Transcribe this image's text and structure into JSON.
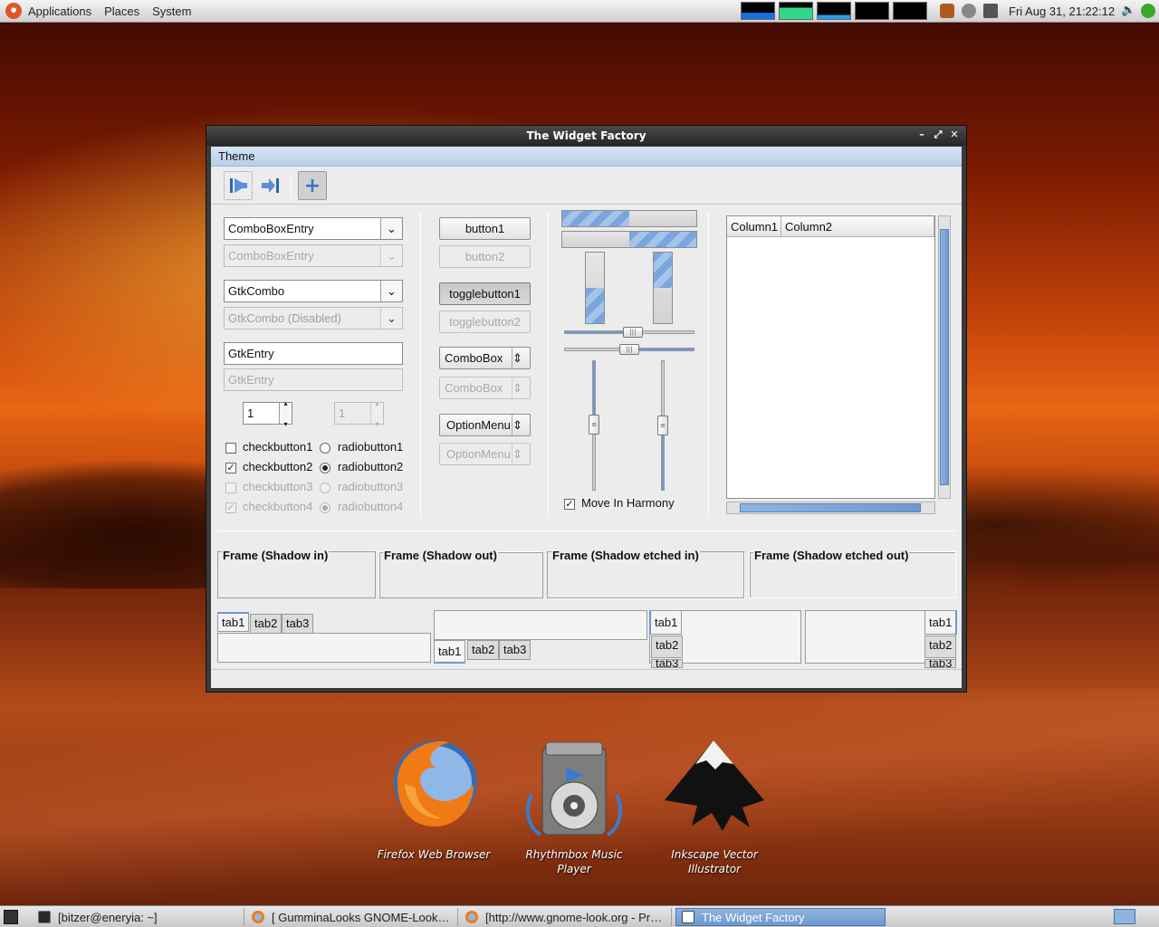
{
  "top_panel": {
    "menus": [
      "Applications",
      "Places",
      "System"
    ],
    "clock": "Fri Aug 31, 21:22:12"
  },
  "bottom_panel": {
    "tasks": [
      {
        "label": "[bitzer@eneryia: ~]",
        "icon": "terminal-icon"
      },
      {
        "label": "[ GumminaLooks GNOME-Look…",
        "icon": "firefox-icon"
      },
      {
        "label": "[http://www.gnome-look.org - Pr…",
        "icon": "firefox-icon"
      },
      {
        "label": "The Widget Factory",
        "icon": "window-icon",
        "active": true
      }
    ]
  },
  "desktop_icons": [
    {
      "label": "Firefox Web Browser",
      "icon": "firefox-icon"
    },
    {
      "label": "Rhythmbox Music Player",
      "icon": "speaker-icon"
    },
    {
      "label": "Inkscape Vector Illustrator",
      "icon": "inkscape-icon"
    }
  ],
  "window": {
    "title": "The Widget Factory",
    "menu": [
      "Theme"
    ],
    "combo_entries": [
      "ComboBoxEntry",
      "ComboBoxEntry",
      "GtkCombo",
      "GtkCombo (Disabled)"
    ],
    "entries": [
      "GtkEntry",
      "GtkEntry"
    ],
    "spinbuttons": [
      "1",
      "1"
    ],
    "checkbuttons": [
      {
        "label": "checkbutton1",
        "checked": false,
        "disabled": false
      },
      {
        "label": "checkbutton2",
        "checked": true,
        "disabled": false
      },
      {
        "label": "checkbutton3",
        "checked": false,
        "disabled": true
      },
      {
        "label": "checkbutton4",
        "checked": true,
        "disabled": true
      }
    ],
    "radiobuttons": [
      {
        "label": "radiobutton1",
        "selected": false,
        "disabled": false
      },
      {
        "label": "radiobutton2",
        "selected": true,
        "disabled": false
      },
      {
        "label": "radiobutton3",
        "selected": false,
        "disabled": true
      },
      {
        "label": "radiobutton4",
        "selected": true,
        "disabled": true
      }
    ],
    "buttons": [
      "button1",
      "button2",
      "togglebutton1",
      "togglebutton2"
    ],
    "comboboxes": [
      "ComboBox",
      "ComboBox",
      "OptionMenu",
      "OptionMenu"
    ],
    "progress": {
      "h1": 0.5,
      "h2": 0.5,
      "v1": 0.5,
      "v2": 0.5
    },
    "move_in_harmony": {
      "label": "Move In Harmony",
      "checked": true
    },
    "tree_columns": [
      "Column1",
      "Column2"
    ],
    "frames": [
      "Frame (Shadow in)",
      "Frame (Shadow out)",
      "Frame (Shadow etched in)",
      "Frame (Shadow etched out)"
    ],
    "tabs": [
      "tab1",
      "tab2",
      "tab3"
    ]
  },
  "colors": {
    "accent": "#6d99d0",
    "titlebar": "#262626"
  }
}
